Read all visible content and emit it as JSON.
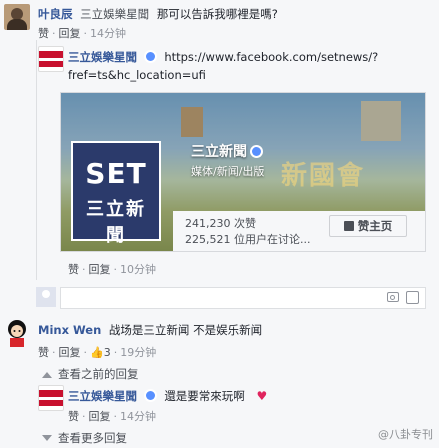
{
  "comments": {
    "c1": {
      "author": "叶良辰",
      "mention": "三立娛樂星聞",
      "text": "那可以告訴我哪裡是嗎?",
      "like": "赞",
      "reply": "回复",
      "time": "14分钟"
    },
    "c2": {
      "author": "三立娛樂星聞",
      "url_line1": "https://www.facebook.com/setnews/?",
      "url_line2": "fref=ts&hc_location=ufi",
      "card": {
        "logo_big": "SET",
        "logo_small": "三立新聞",
        "page_name": "三立新聞",
        "page_category": "媒体/新闻/出版",
        "deco_text": "新國會",
        "stat_likes": "241,230 次赞",
        "stat_talking": "225,521 位用户在讨论...",
        "like_page_label": "赞主页"
      },
      "like": "赞",
      "reply": "回复",
      "time": "10分钟"
    },
    "reply_box_placeholder": "",
    "c3": {
      "author": "Minx Wen",
      "text": "战场是三立新闻 不是娱乐新闻",
      "like": "赞",
      "reply": "回复",
      "like_count": "3",
      "time": "19分钟"
    },
    "view_previous": "查看之前的回复",
    "c4": {
      "author": "三立娛樂星聞",
      "text": "還是要常來玩啊",
      "heart": "♥",
      "like": "赞",
      "reply": "回复",
      "time": "14分钟"
    },
    "view_more": "查看更多回复"
  },
  "watermark": "@八卦专刊"
}
